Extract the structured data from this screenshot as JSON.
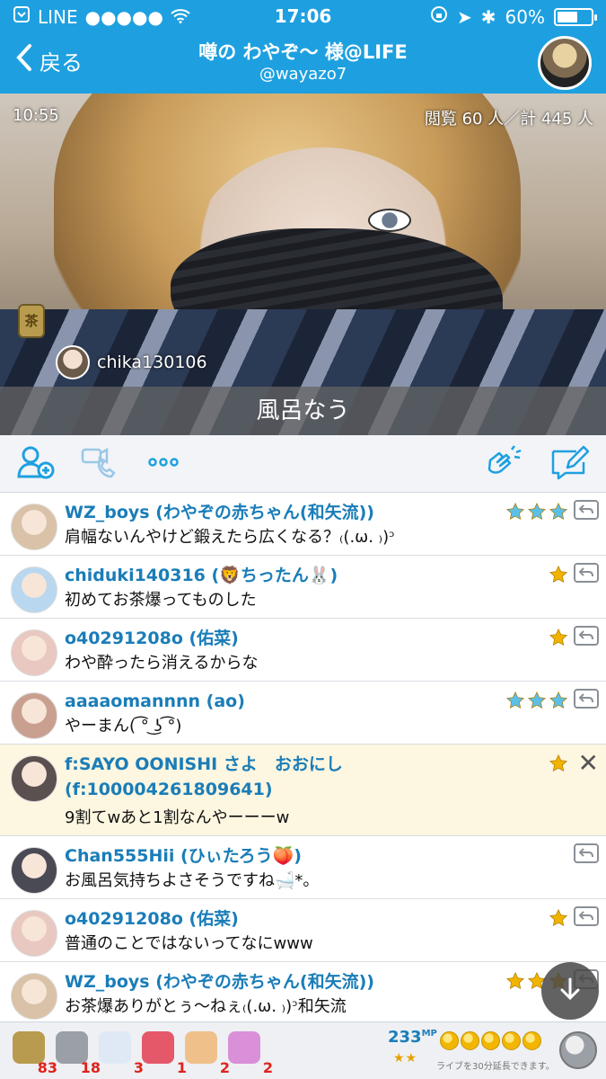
{
  "status": {
    "carrier": "LINE",
    "time": "17:06",
    "battery": "60%",
    "battery_level": 0.6
  },
  "header": {
    "back_label": "戻る",
    "title": "噂の わやぞ〜 様@LIFE",
    "subtitle": "@wayazo7"
  },
  "video": {
    "elapsed": "10:55",
    "viewers": "閲覧 60 人／計 445 人",
    "tea_icon_label": "茶",
    "current_viewer": "chika130106",
    "caption": "風呂なう"
  },
  "comments": [
    {
      "name": "WZ_boys (わやぞの赤ちゃん(和矢流))",
      "message": "肩幅ないんやけど鍛えたら広くなる？₍(.ω. ₎)ᵓ",
      "stars": 3,
      "star_color": "#5bc0e8",
      "avatar_color": "#d9c2a8"
    },
    {
      "name": "chiduki140316 (🦁ちったん🐰)",
      "message": "初めてお茶爆ってものした",
      "stars": 1,
      "star_color": "#f0b400",
      "avatar_color": "#b9d8f0"
    },
    {
      "name": "o40291208o (佑菜)",
      "message": "わや酔ったら消えるからな",
      "stars": 1,
      "star_color": "#f0b400",
      "avatar_color": "#e8c8c0"
    },
    {
      "name": "aaaaomannnn (ao)",
      "message": "やーまん( ͡° ͜ʖ ͡°)",
      "stars": 3,
      "star_color": "#5bc0e8",
      "avatar_color": "#c9a090"
    },
    {
      "name": "f:SAYO OONISHI さよ　おおにし (f:100004261809641)",
      "message": "9割てwあと1割なんやーーーw",
      "stars": 1,
      "star_color": "#f0b400",
      "avatar_color": "#5a5050",
      "highlight": true
    },
    {
      "name": "Chan555Hii (ひぃたろう🍑)",
      "message": "お風呂気持ちよさそうですね🛁*。",
      "stars": 0,
      "star_color": "#f0b400",
      "avatar_color": "#4a4a55"
    },
    {
      "name": "o40291208o (佑菜)",
      "message": "普通のことではないってなにwww",
      "stars": 1,
      "star_color": "#f0b400",
      "avatar_color": "#e8c8c0"
    },
    {
      "name": "WZ_boys (わやぞの赤ちゃん(和矢流))",
      "message": "お茶爆ありがとぅ〜ねぇ₍(.ω. ₎)ᵓ和矢流",
      "stars": 3,
      "star_color": "#f0b400",
      "avatar_color": "#d9c2a8"
    }
  ],
  "gifts": [
    {
      "icon": "tea-can-icon",
      "count": "83",
      "color": "#b89b4f"
    },
    {
      "icon": "silver-coin-icon",
      "count": "18",
      "color": "#9aa0a6"
    },
    {
      "icon": "ghost-icon",
      "count": "3",
      "color": "#dfe9f5"
    },
    {
      "icon": "fireworks-icon",
      "count": "1",
      "color": "#e4586a"
    },
    {
      "icon": "clap-hands-icon",
      "count": "2",
      "color": "#f0c08a"
    },
    {
      "icon": "bear-icon",
      "count": "2",
      "color": "#d990d8"
    }
  ],
  "mp": {
    "value": "233",
    "unit": "MP",
    "stars": "★★",
    "coins": 5,
    "note": "ライブを30分延長できます。"
  }
}
